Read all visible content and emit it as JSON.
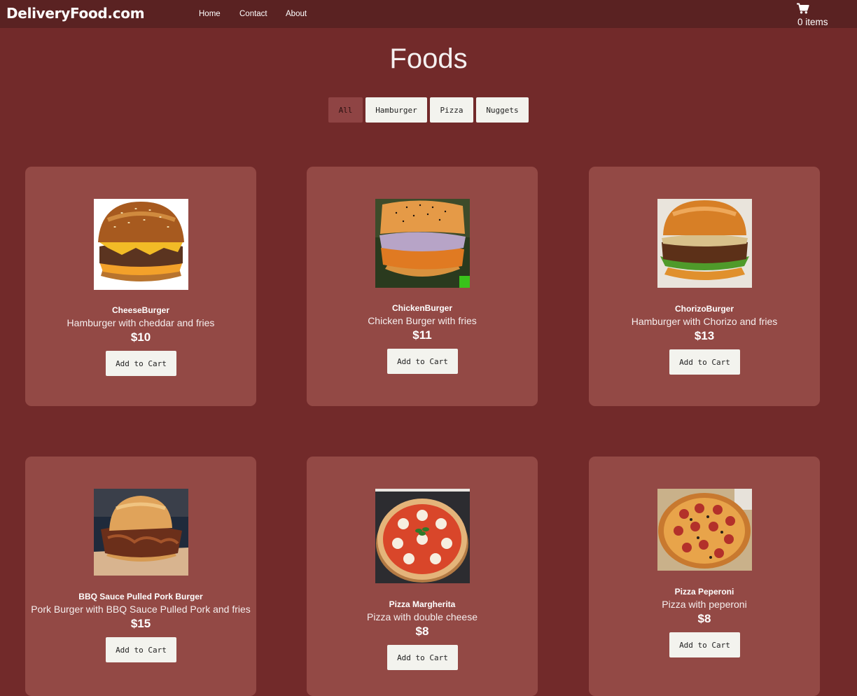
{
  "nav": {
    "brand": "DeliveryFood.com",
    "links": [
      "Home",
      "Contact",
      "About"
    ],
    "cart_icon": "shopping-cart-icon",
    "cart_count": "0 items"
  },
  "main": {
    "title": "Foods",
    "filters": [
      "All",
      "Hamburger",
      "Pizza",
      "Nuggets"
    ],
    "active_filter": "All",
    "add_to_cart_label": "Add to Cart",
    "products": [
      {
        "name": "CheeseBurger",
        "description": "Hamburger with cheddar and fries",
        "price": "$10",
        "image": "cheeseburger-photo"
      },
      {
        "name": "ChickenBurger",
        "description": "Chicken Burger with fries",
        "price": "$11",
        "image": "chickenburger-photo"
      },
      {
        "name": "ChorizoBurger",
        "description": "Hamburger with Chorizo and fries",
        "price": "$13",
        "image": "chorizoburger-photo"
      },
      {
        "name": "BBQ Sauce Pulled Pork Burger",
        "description": "Pork Burger with BBQ Sauce Pulled Pork and fries",
        "price": "$15",
        "image": "pulled-pork-burger-photo"
      },
      {
        "name": "Pizza Margherita",
        "description": "Pizza with double cheese",
        "price": "$8",
        "image": "pizza-margherita-photo"
      },
      {
        "name": "Pizza Peperoni",
        "description": "Pizza with peperoni",
        "price": "$8",
        "image": "pizza-peperoni-photo"
      }
    ]
  },
  "colors": {
    "background": "#722a2a",
    "navbar": "#5a2222",
    "card": "#934945",
    "button": "#f3f3ee",
    "active_filter": "#8f4444"
  }
}
